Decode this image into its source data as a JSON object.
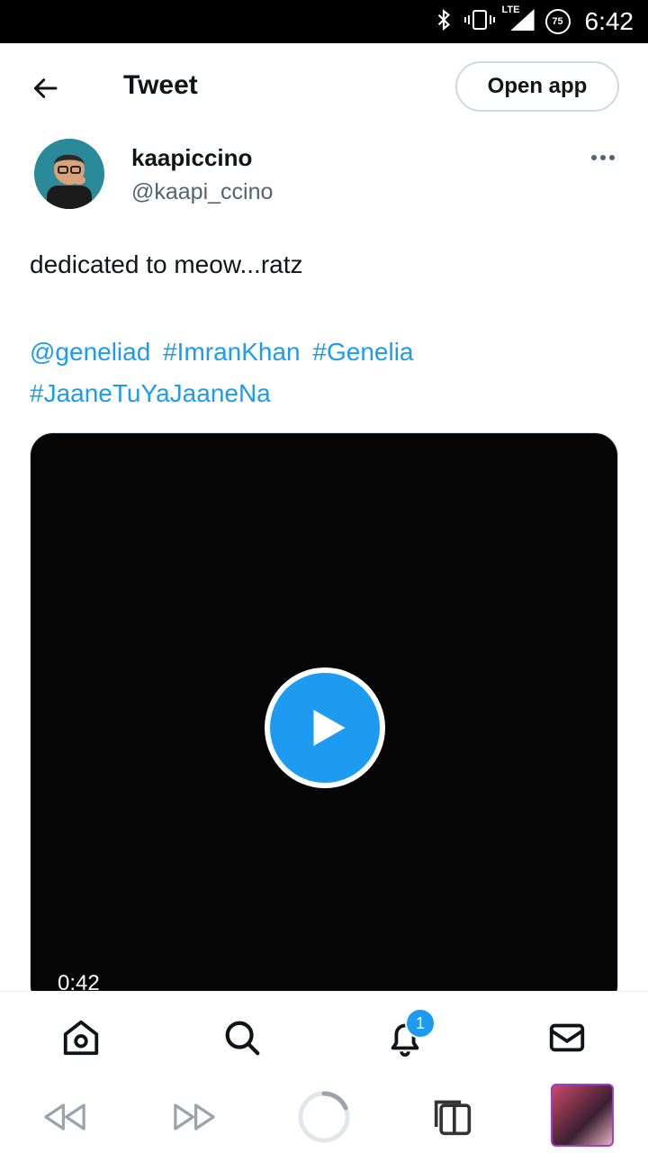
{
  "status_bar": {
    "network": "LTE",
    "battery": "75",
    "time": "6:42"
  },
  "header": {
    "title": "Tweet",
    "open_app_label": "Open app"
  },
  "tweet": {
    "display_name": "kaapiccino",
    "handle": "@kaapi_ccino",
    "text": "dedicated to meow...ratz",
    "mention": "@geneliad",
    "hashtags": [
      "#ImranKhan",
      "#Genelia",
      "#JaaneTuYaJaaneNa"
    ]
  },
  "video": {
    "duration": "0:42"
  },
  "bottom_nav": {
    "notifications_badge": "1"
  },
  "colors": {
    "accent": "#1d9bf0",
    "text": "#0f1419",
    "muted": "#536471"
  },
  "icons": [
    "back-arrow-icon",
    "more-icon",
    "play-icon",
    "home-icon",
    "search-icon",
    "bell-icon",
    "mail-icon",
    "rewind-icon",
    "fast-forward-icon",
    "reload-icon",
    "tabs-icon"
  ]
}
